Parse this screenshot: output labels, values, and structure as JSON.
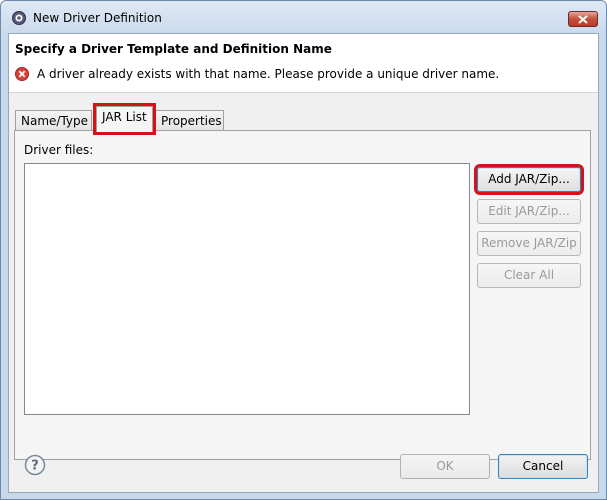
{
  "window": {
    "title": "New Driver Definition",
    "icon": "eclipse-gear-icon",
    "close_icon": "close-icon"
  },
  "header": {
    "title": "Specify a Driver Template and Definition Name",
    "error_icon": "error-icon",
    "error_color": "#d8403a",
    "message": "A driver already exists with that name. Please provide a unique driver name."
  },
  "tabs": [
    {
      "label": "Name/Type",
      "active": false
    },
    {
      "label": "JAR List",
      "active": true
    },
    {
      "label": "Properties",
      "active": false
    }
  ],
  "jar_panel": {
    "files_label": "Driver files:",
    "buttons": {
      "add": "Add JAR/Zip...",
      "edit": "Edit JAR/Zip...",
      "remove": "Remove JAR/Zip",
      "clear": "Clear All"
    }
  },
  "footer": {
    "help_icon": "help-icon",
    "ok": "OK",
    "cancel": "Cancel"
  },
  "colors": {
    "highlight": "#d3121a",
    "frame": "#c9d9ec"
  }
}
